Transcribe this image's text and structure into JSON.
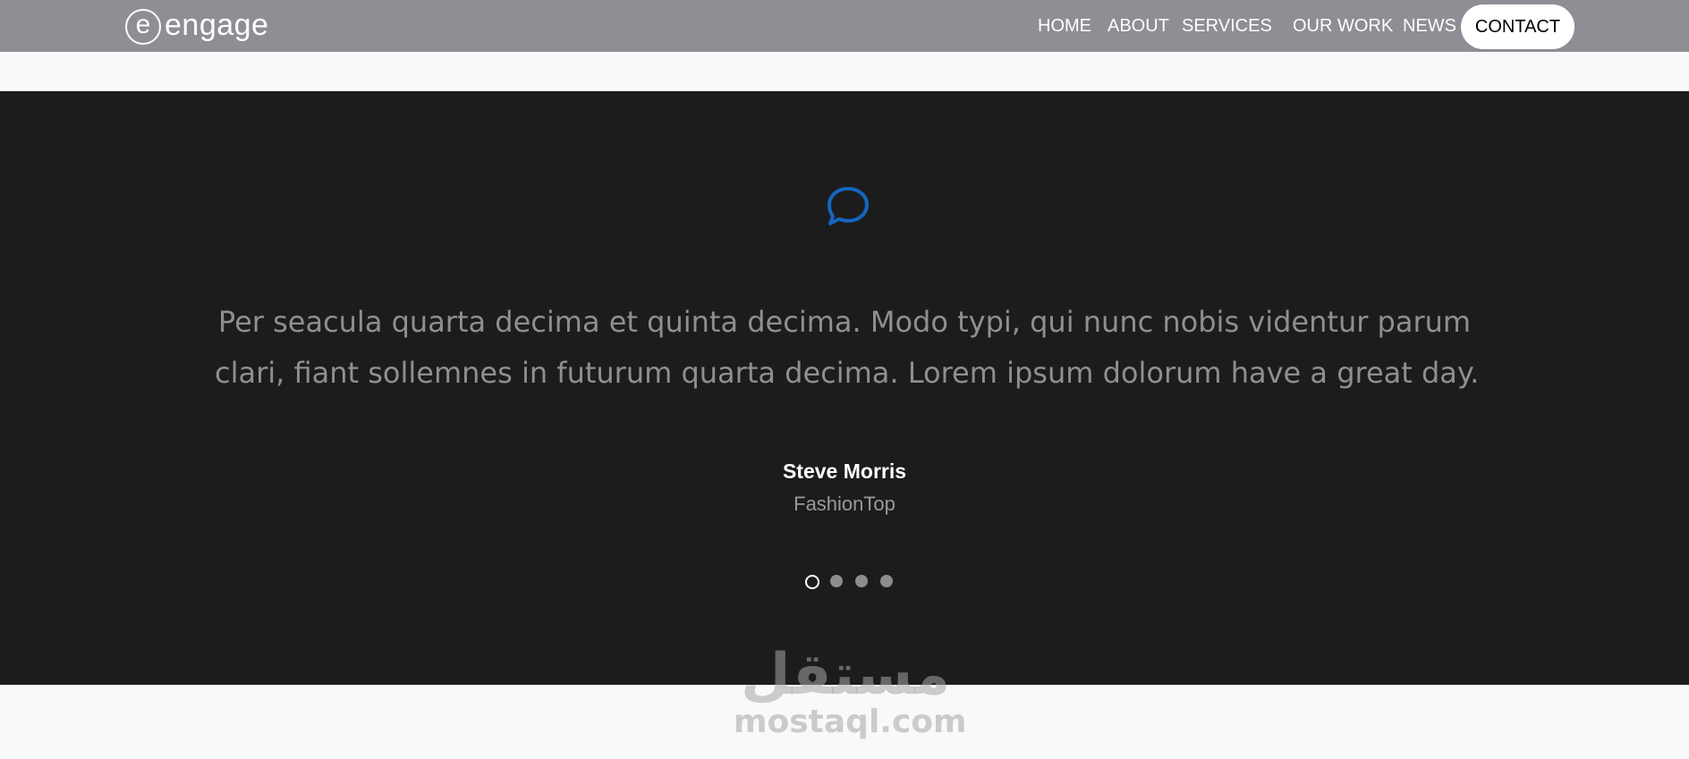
{
  "header": {
    "logo_letter": "e",
    "logo_text": "engage",
    "nav": [
      "HOME",
      "ABOUT",
      "SERVICES",
      "OUR WORK",
      "NEWS"
    ],
    "contact_label": "CONTACT"
  },
  "testimonial": {
    "icon": "speech-bubble-icon",
    "icon_color": "#1565c0",
    "quote_lines": [
      "Per seacula quarta decima et quinta decima. Modo typi, qui nunc nobis videntur parum",
      "clari, fiant sollemnes in futurum quarta decima. Lorem ipsum dolorum have a great day."
    ],
    "author": "Steve Morris",
    "company": "FashionTop",
    "slides_count": 4,
    "active_slide": 1
  },
  "watermark": {
    "arabic": "مستقل",
    "latin": "mostaql.com"
  }
}
